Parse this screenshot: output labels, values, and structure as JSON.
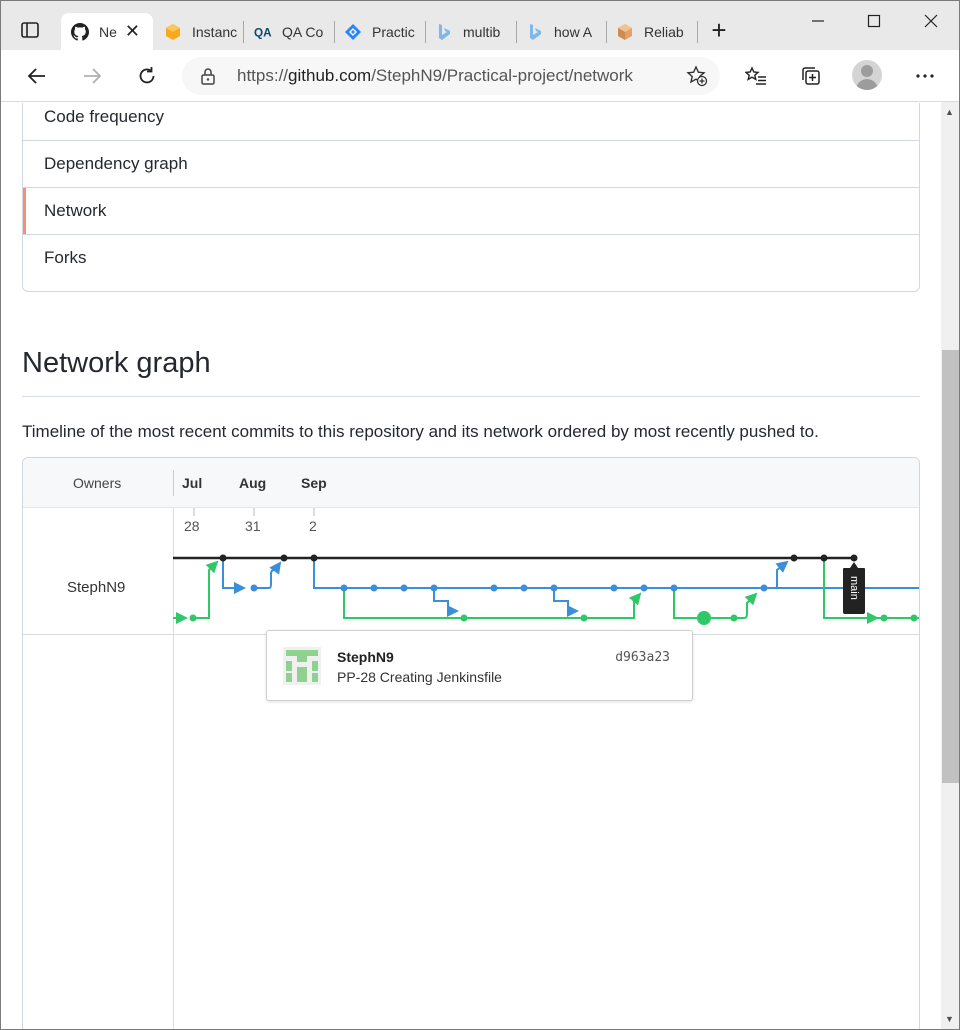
{
  "browser": {
    "tabs": [
      {
        "title": "Ne",
        "icon": "github-icon",
        "active": true
      },
      {
        "title": "Instanc",
        "icon": "aws-icon"
      },
      {
        "title": "QA Co",
        "icon": "qa-icon"
      },
      {
        "title": "Practic",
        "icon": "jira-icon"
      },
      {
        "title": "multib",
        "icon": "bing-icon"
      },
      {
        "title": "how A",
        "icon": "bing-icon"
      },
      {
        "title": "Reliab",
        "icon": "box-icon"
      }
    ],
    "url_prefix": "https://",
    "url_host": "github.com",
    "url_path": "/StephN9/Practical-project/network"
  },
  "sidebar_menu": {
    "items": [
      {
        "label": "Code frequency"
      },
      {
        "label": "Dependency graph"
      },
      {
        "label": "Network",
        "selected": true
      },
      {
        "label": "Forks"
      }
    ]
  },
  "network": {
    "heading": "Network graph",
    "description": "Timeline of the most recent commits to this repository and its network ordered by most recently pushed to.",
    "owners_label": "Owners",
    "months": [
      "Jul",
      "Aug",
      "Sep"
    ],
    "days": [
      "28",
      "31",
      "2"
    ],
    "owner": "StephN9",
    "branch_label": "main",
    "colors": {
      "main": "#222222",
      "blue": "#3a8fd8",
      "green": "#2ec866"
    },
    "tooltip": {
      "author": "StephN9",
      "message": "PP-28 Creating Jenkinsfile",
      "sha": "d963a23"
    }
  }
}
